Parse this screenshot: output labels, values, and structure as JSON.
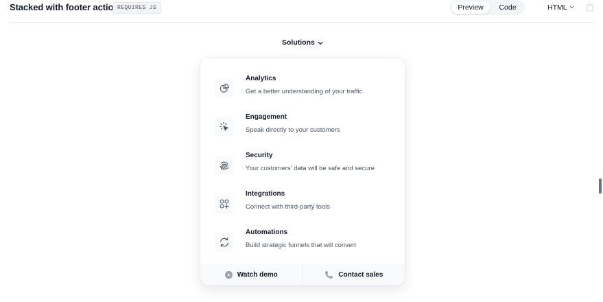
{
  "header": {
    "title": "Stacked with footer actions",
    "badge": "REQUIRES JS",
    "tabs": [
      {
        "label": "Preview",
        "active": true
      },
      {
        "label": "Code",
        "active": false
      }
    ],
    "language": "HTML"
  },
  "menu": {
    "trigger_label": "Solutions",
    "items": [
      {
        "icon": "chart-pie-icon",
        "title": "Analytics",
        "description": "Get a better understanding of your traffic"
      },
      {
        "icon": "cursor-click-icon",
        "title": "Engagement",
        "description": "Speak directly to your customers"
      },
      {
        "icon": "fingerprint-icon",
        "title": "Security",
        "description": "Your customers' data will be safe and secure"
      },
      {
        "icon": "squares-plus-icon",
        "title": "Integrations",
        "description": "Connect with third-party tools"
      },
      {
        "icon": "arrow-path-icon",
        "title": "Automations",
        "description": "Build strategic funnels that will convert"
      }
    ],
    "footer": [
      {
        "icon": "play-circle-icon",
        "label": "Watch demo"
      },
      {
        "icon": "phone-icon",
        "label": "Contact sales"
      }
    ]
  },
  "colors": {
    "text": "#111827",
    "muted": "#4b5563",
    "icon": "#4b5563",
    "footer_bg": "#f9fafb",
    "segment_bg": "#f3f4f6"
  }
}
